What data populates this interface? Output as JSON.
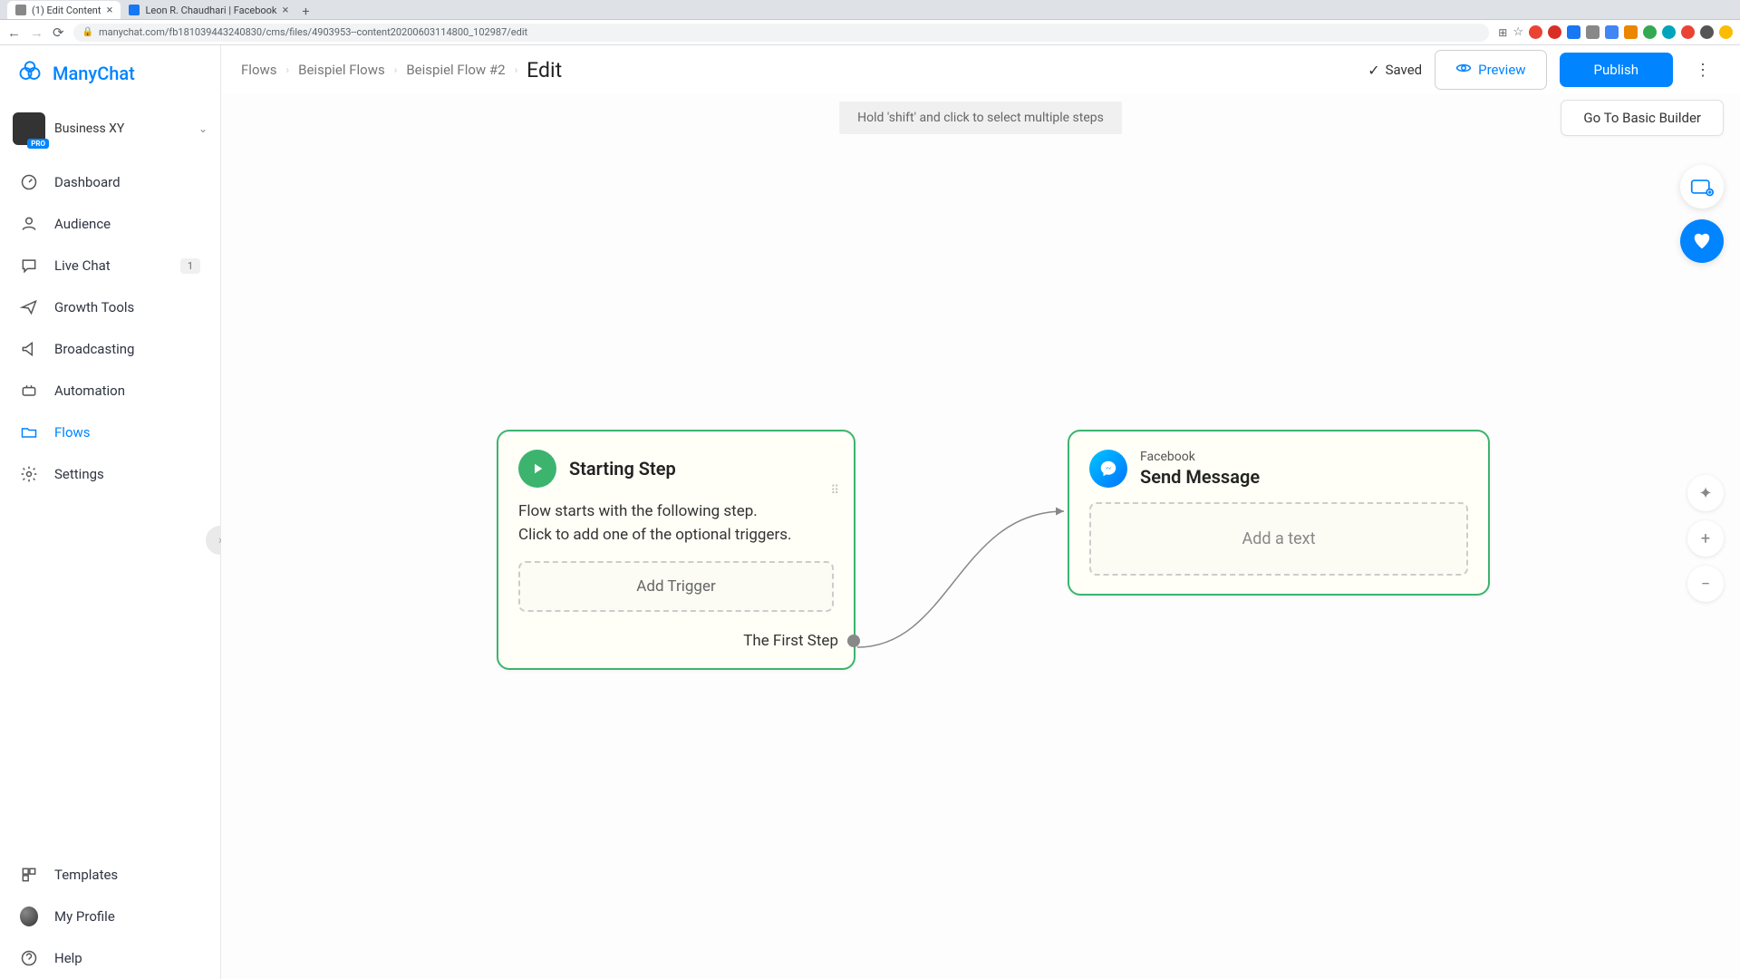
{
  "browser": {
    "tabs": [
      {
        "title": "(1) Edit Content"
      },
      {
        "title": "Leon R. Chaudhari | Facebook"
      }
    ],
    "url": "manychat.com/fb181039443240830/cms/files/4903953--content20200603114800_102987/edit"
  },
  "app": {
    "logo_text": "ManyChat",
    "account_name": "Business XY",
    "pro_badge": "PRO"
  },
  "sidebar": {
    "items": [
      {
        "label": "Dashboard"
      },
      {
        "label": "Audience"
      },
      {
        "label": "Live Chat",
        "badge": "1"
      },
      {
        "label": "Growth Tools"
      },
      {
        "label": "Broadcasting"
      },
      {
        "label": "Automation"
      },
      {
        "label": "Flows"
      },
      {
        "label": "Settings"
      }
    ],
    "bottom": [
      {
        "label": "Templates"
      },
      {
        "label": "My Profile"
      },
      {
        "label": "Help"
      }
    ]
  },
  "header": {
    "breadcrumb": [
      "Flows",
      "Beispiel Flows",
      "Beispiel Flow #2"
    ],
    "edit": "Edit",
    "saved": "Saved",
    "preview": "Preview",
    "publish": "Publish"
  },
  "canvas": {
    "hint": "Hold 'shift' and click to select multiple steps",
    "basic_builder": "Go To Basic Builder",
    "start_node": {
      "title": "Starting Step",
      "body_line1": "Flow starts with the following step.",
      "body_line2": "Click to add one of the optional triggers.",
      "add_trigger": "Add Trigger",
      "first_step": "The First Step"
    },
    "send_node": {
      "subtitle": "Facebook",
      "title": "Send Message",
      "add_text": "Add a text"
    }
  }
}
